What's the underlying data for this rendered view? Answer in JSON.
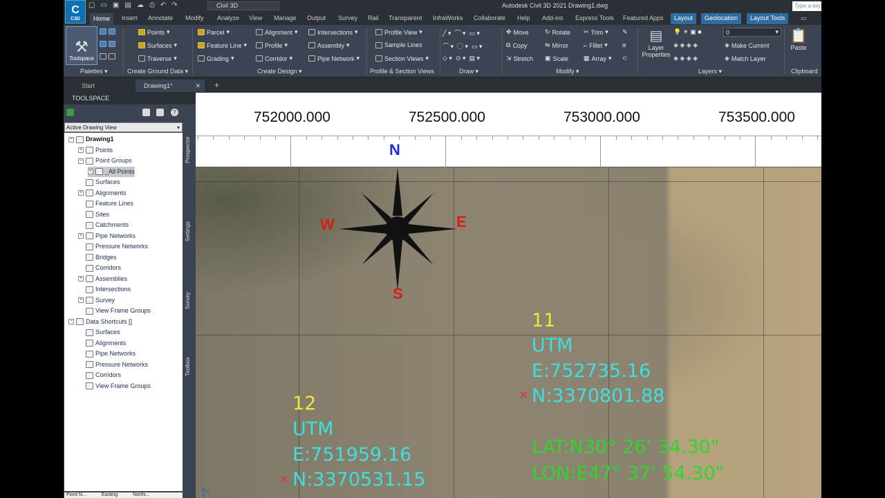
{
  "app": {
    "logo_text": "C",
    "logo_sub": "C3D",
    "workspace": "Civil 3D",
    "title": "Autodesk Civil 3D 2021   Drawing1.dwg",
    "search_placeholder": "Type a key"
  },
  "ribbon_tabs": [
    "Home",
    "Insert",
    "Annotate",
    "Modify",
    "Analyze",
    "View",
    "Manage",
    "Output",
    "Survey",
    "Rail",
    "Transparent",
    "InfraWorks",
    "Collaborate",
    "Help",
    "Add-ins",
    "Express Tools",
    "Featured Apps"
  ],
  "contextual_tabs": [
    "Layout",
    "Geolocation",
    "Layout Tools"
  ],
  "ribbon": {
    "toolspace_label": "Toolspace",
    "groups": {
      "palettes": "Palettes",
      "create_ground_data": "Create Ground Data",
      "create_design": "Create Design",
      "profile_section_views": "Profile & Section Views",
      "draw": "Draw",
      "modify": "Modify",
      "layers": "Layers",
      "clipboard": "Clipboard"
    },
    "ground_items": [
      "Points",
      "Surfaces",
      "Traverse"
    ],
    "design_items_1": [
      "Parcel",
      "Feature Line",
      "Grading"
    ],
    "design_items_2": [
      "Alignment",
      "Profile",
      "Corridor"
    ],
    "design_items_3": [
      "Intersections",
      "Assembly",
      "Pipe Network"
    ],
    "view_items": [
      "Profile View",
      "Sample Lines",
      "Section Views"
    ],
    "modify_items_1": [
      "Move",
      "Copy",
      "Stretch"
    ],
    "modify_items_2": [
      "Rotate",
      "Mirror",
      "Scale"
    ],
    "modify_items_3": [
      "Trim",
      "Fillet",
      "Array"
    ],
    "layer_properties": "Layer Properties",
    "layer_current": "0",
    "make_current": "Make Current",
    "match_layer": "Match Layer",
    "paste": "Paste"
  },
  "file_tabs": {
    "start": "Start",
    "drawing": "Drawing1*",
    "close": "✕",
    "new": "+"
  },
  "toolspace": {
    "title": "TOOLSPACE",
    "view_select": "Active Drawing View",
    "tree": [
      {
        "label": "Drawing1",
        "level": 0,
        "bold": true,
        "exp": "−"
      },
      {
        "label": "Points",
        "level": 1,
        "exp": "+"
      },
      {
        "label": "Point Groups",
        "level": 1,
        "exp": "−"
      },
      {
        "label": "_All Points",
        "level": 2,
        "exp": "+",
        "sel": true
      },
      {
        "label": "Surfaces",
        "level": 1,
        "exp": ""
      },
      {
        "label": "Alignments",
        "level": 1,
        "exp": "+"
      },
      {
        "label": "Feature Lines",
        "level": 1,
        "exp": ""
      },
      {
        "label": "Sites",
        "level": 1,
        "exp": ""
      },
      {
        "label": "Catchments",
        "level": 1,
        "exp": ""
      },
      {
        "label": "Pipe Networks",
        "level": 1,
        "exp": "+"
      },
      {
        "label": "Pressure Networks",
        "level": 1,
        "exp": ""
      },
      {
        "label": "Bridges",
        "level": 1,
        "exp": ""
      },
      {
        "label": "Corridors",
        "level": 1,
        "exp": ""
      },
      {
        "label": "Assemblies",
        "level": 1,
        "exp": "+"
      },
      {
        "label": "Intersections",
        "level": 1,
        "exp": ""
      },
      {
        "label": "Survey",
        "level": 1,
        "exp": "+"
      },
      {
        "label": "View Frame Groups",
        "level": 1,
        "exp": ""
      },
      {
        "label": "Data Shortcuts []",
        "level": 0,
        "exp": "−"
      },
      {
        "label": "Surfaces",
        "level": 1,
        "exp": ""
      },
      {
        "label": "Alignments",
        "level": 1,
        "exp": ""
      },
      {
        "label": "Pipe Networks",
        "level": 1,
        "exp": ""
      },
      {
        "label": "Pressure Networks",
        "level": 1,
        "exp": ""
      },
      {
        "label": "Corridors",
        "level": 1,
        "exp": ""
      },
      {
        "label": "View Frame Groups",
        "level": 1,
        "exp": ""
      }
    ],
    "vertical_tabs": [
      "Prospector",
      "Settings",
      "Survey",
      "Toolbox"
    ],
    "bottom_cols": [
      "Point N...",
      "Easting",
      "Northi..."
    ]
  },
  "drawing": {
    "ruler_labels": [
      "752000.000",
      "752500.000",
      "753000.000",
      "753500.000"
    ],
    "compass": {
      "n": "N",
      "s": "S",
      "e": "E",
      "w": "W"
    },
    "point11": {
      "number": "11",
      "system": "UTM",
      "easting": "E:752735.16",
      "northing": "N:3370801.88",
      "lat": "LAT:N30° 26' 34.30\"",
      "lon": "LON:E47° 37' 54.30\""
    },
    "point12": {
      "number": "12",
      "system": "UTM",
      "easting": "E:751959.16",
      "northing": "N:3370531.15"
    },
    "marker": "×"
  },
  "colors": {
    "point_number": "#f2e838",
    "utm_text": "#41dede",
    "latlon_text": "#2fd62f",
    "compass_n": "#1a2fd6",
    "compass_ews": "#d81c1c"
  }
}
